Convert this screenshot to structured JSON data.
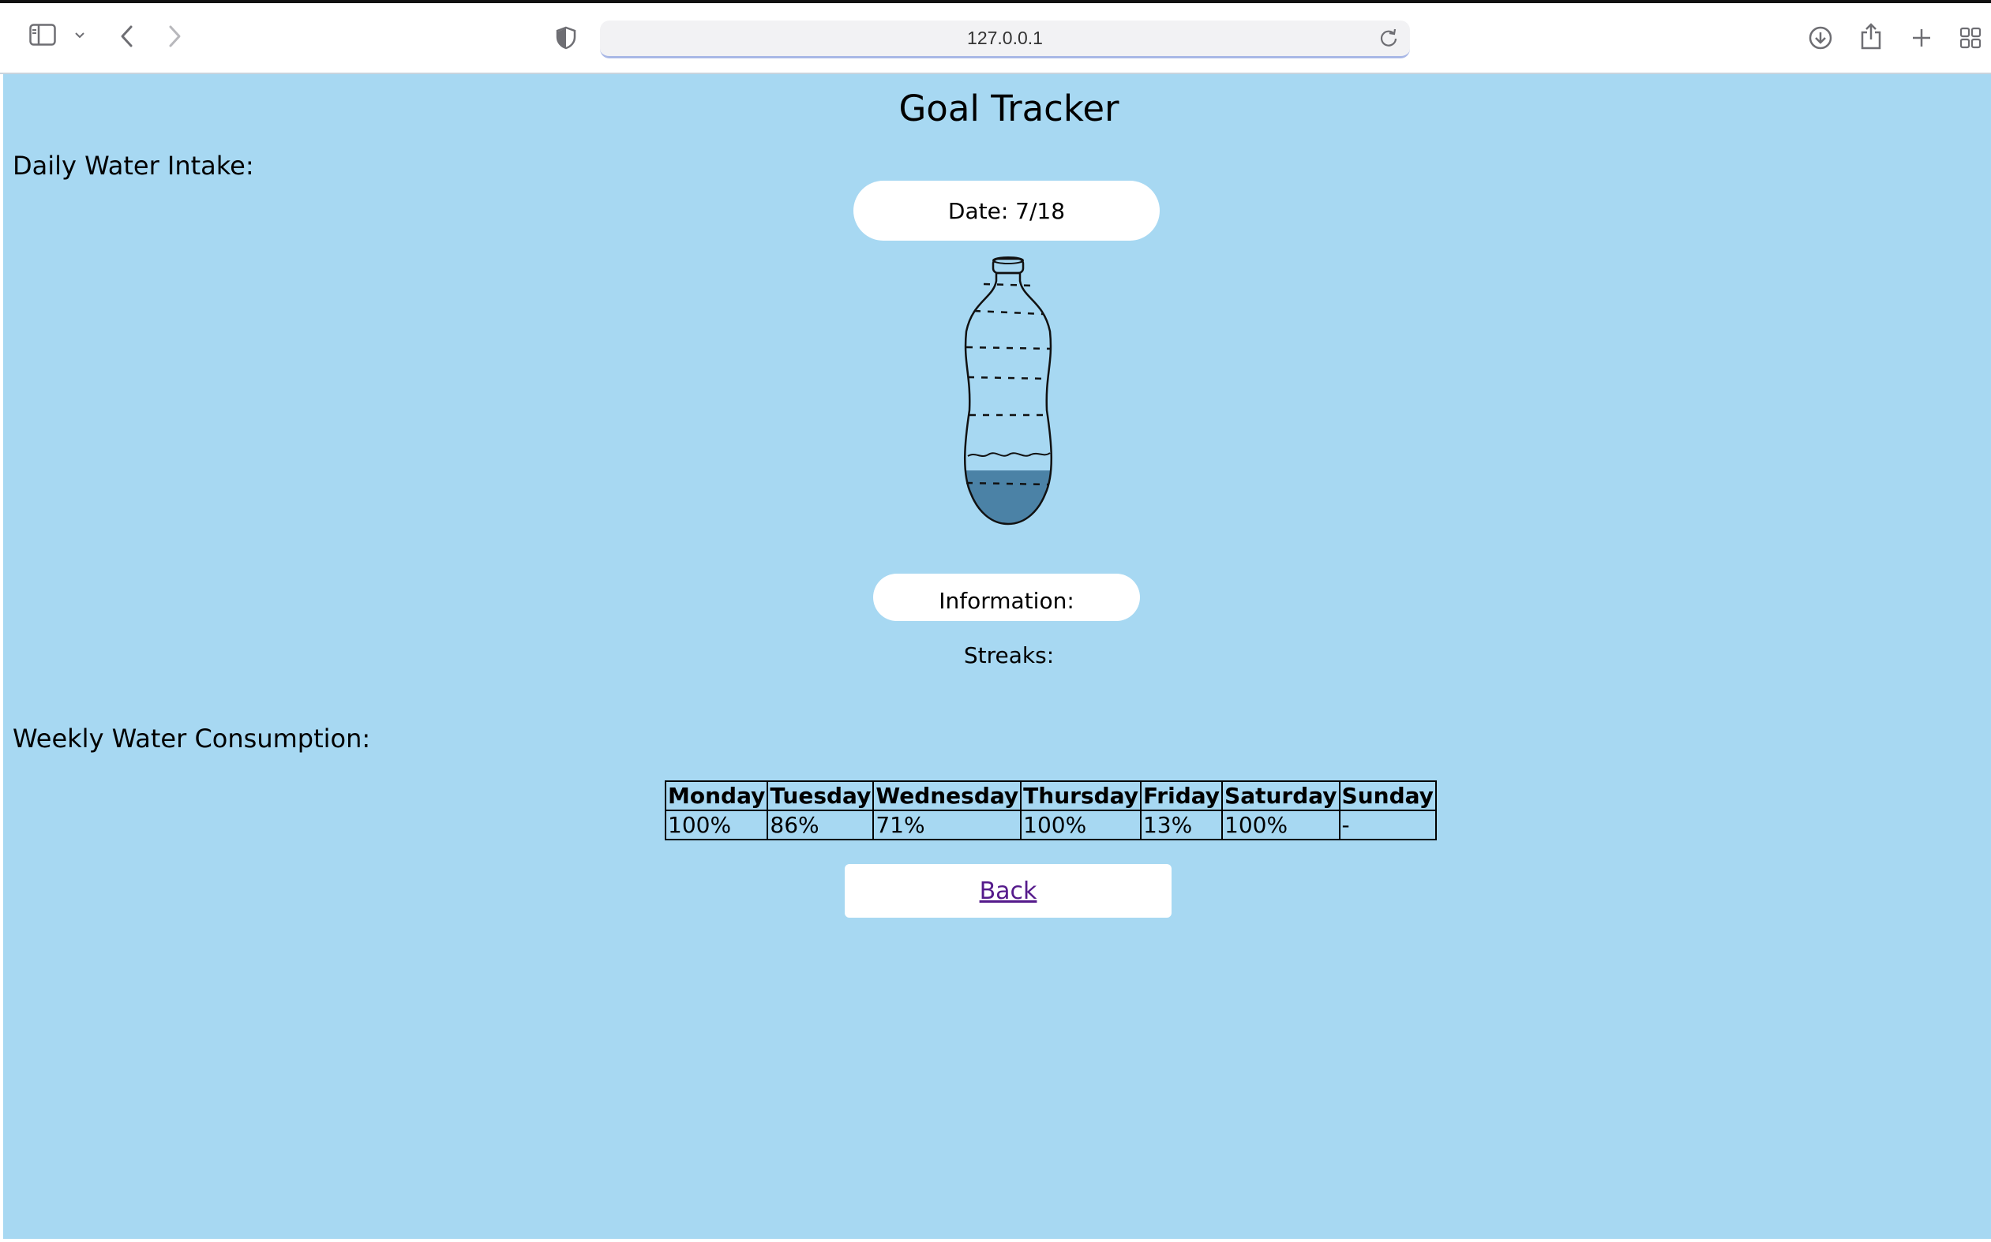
{
  "browser": {
    "url": "127.0.0.1"
  },
  "page": {
    "title": "Goal Tracker",
    "daily_label": "Daily Water Intake:",
    "date_label": "Date: 7/18",
    "bottle_fill_fraction": 0.22,
    "information_label": "Information:",
    "streaks_label": "Streaks:",
    "weekly_label": "Weekly Water Consumption:",
    "weekly_table": {
      "headers": [
        "Monday",
        "Tuesday",
        "Wednesday",
        "Thursday",
        "Friday",
        "Saturday",
        "Sunday"
      ],
      "values": [
        "100%",
        "86%",
        "71%",
        "100%",
        "13%",
        "100%",
        "-"
      ]
    },
    "back_label": "Back"
  },
  "colors": {
    "page_background": "#a7d8f2",
    "water": "#4b82a6",
    "link": "#551a8b"
  },
  "icons": [
    "sidebar-icon",
    "chevron-down-icon",
    "back-arrow-icon",
    "forward-arrow-icon",
    "shield-icon",
    "reload-icon",
    "download-icon",
    "share-icon",
    "plus-icon",
    "tab-overview-icon"
  ]
}
